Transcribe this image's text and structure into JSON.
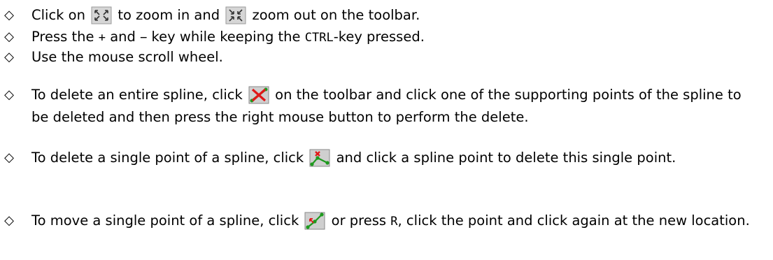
{
  "bullet_glyph": "◇",
  "zoom": {
    "item1": {
      "part1": "Click on",
      "zoom_in_icon": "zoom-in-icon",
      "part2": "to zoom in and",
      "zoom_out_icon": "zoom-out-icon",
      "part3": "zoom out on the toolbar."
    },
    "item2": {
      "part1": "Press the",
      "plus": "+",
      "part2": "and",
      "minus": "−",
      "part3": "key while keeping the",
      "ctrl": "CTRL",
      "part4": "-key pressed."
    },
    "item3": {
      "text": "Use the mouse scroll wheel."
    }
  },
  "spline": {
    "item1": {
      "part1": "To delete an entire spline, click",
      "icon": "delete-spline-icon",
      "part2": "on the toolbar and click one of the supporting points of the spline to be deleted and then press the right mouse button to perform the delete."
    },
    "item2": {
      "part1": "To delete a single point of a spline, click",
      "icon": "delete-point-icon",
      "part2": "and click a spline point to delete this single point."
    },
    "item3": {
      "part1": "To move a single point of a spline, click",
      "icon": "move-point-icon",
      "part2": "or press",
      "key": "R",
      "part3": ", click the point and click again at the new location."
    }
  }
}
